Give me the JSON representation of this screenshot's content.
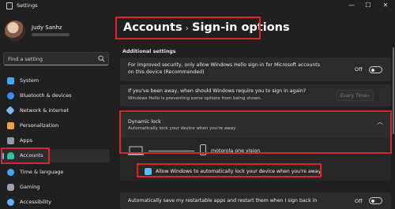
{
  "window": {
    "title": "Settings",
    "controls": {
      "minimize": "—",
      "maximize": "☐",
      "close": "✕"
    }
  },
  "user": {
    "name": "Judy Sanhz"
  },
  "search": {
    "placeholder": "Find a setting"
  },
  "sidebar": {
    "items": [
      {
        "label": "System",
        "icon": "system-icon",
        "color": "#4aa3ff"
      },
      {
        "label": "Bluetooth & devices",
        "icon": "bluetooth-icon",
        "color": "#3d8bff"
      },
      {
        "label": "Network & internet",
        "icon": "network-icon",
        "color": "#7fb6ff"
      },
      {
        "label": "Personalization",
        "icon": "personalization-icon",
        "color": "#f0a43a"
      },
      {
        "label": "Apps",
        "icon": "apps-icon",
        "color": "#8b9bb0"
      },
      {
        "label": "Accounts",
        "icon": "accounts-icon",
        "color": "#2ec4a0",
        "active": true
      },
      {
        "label": "Time & language",
        "icon": "time-language-icon",
        "color": "#3fa9f5"
      },
      {
        "label": "Gaming",
        "icon": "gaming-icon",
        "color": "#9aa4b0"
      },
      {
        "label": "Accessibility",
        "icon": "accessibility-icon",
        "color": "#5ab0ff"
      }
    ]
  },
  "breadcrumb": {
    "parent": "Accounts",
    "separator": "›",
    "current": "Sign-in options"
  },
  "section": {
    "title": "Additional settings"
  },
  "settings": {
    "hello_only": {
      "text_line1": "For improved security, only allow Windows Hello sign-in for Microsoft accounts",
      "text_line2": "on this device (Recommended)",
      "toggle_label": "Off"
    },
    "signin_again": {
      "title": "If you've been away, when should Windows require you to sign in again?",
      "subtitle": "Windows Hello is preventing some options from being shown.",
      "dropdown_value": "Every Time"
    },
    "dynamic_lock": {
      "title": "Dynamic lock",
      "subtitle": "Automatically lock your device when you're away",
      "device_name": "motorola one vision",
      "checkbox_label": "Allow Windows to automatically lock your device when you're away",
      "checked": true
    },
    "restart_apps": {
      "text": "Automatically save my restartable apps and restart them when I sign back in",
      "toggle_label": "Off"
    }
  },
  "colors": {
    "accent": "#4cc2ff",
    "highlight": "#d9262c",
    "background": "#202020",
    "card": "#2b2b2b"
  }
}
